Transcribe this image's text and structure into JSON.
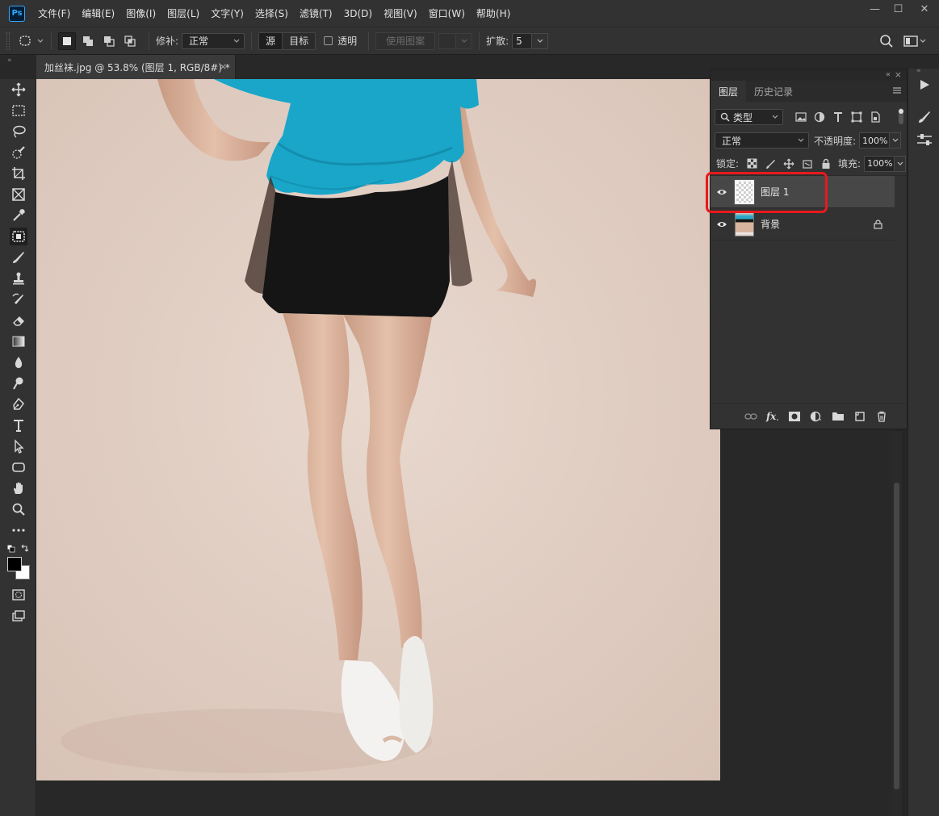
{
  "menu": {
    "logo": "Ps",
    "items": [
      "文件(F)",
      "编辑(E)",
      "图像(I)",
      "图层(L)",
      "文字(Y)",
      "选择(S)",
      "滤镜(T)",
      "3D(D)",
      "视图(V)",
      "窗口(W)",
      "帮助(H)"
    ]
  },
  "window_controls": {
    "minimize": "—",
    "maximize": "☐",
    "close": "✕"
  },
  "options": {
    "repair_label": "修补:",
    "repair_mode": "正常",
    "source": "源",
    "target": "目标",
    "transparent_label": "透明",
    "use_pattern": "使用图案",
    "diffusion_label": "扩散:",
    "diffusion_value": "5"
  },
  "document": {
    "tab_title": "加丝袜.jpg @ 53.8% (图层 1, RGB/8#) *",
    "close": "×"
  },
  "layers_panel": {
    "tabs": [
      "图层",
      "历史记录"
    ],
    "filter_label": "类型",
    "blend_mode": "正常",
    "opacity_label": "不透明度:",
    "opacity_value": "100%",
    "lock_label": "锁定:",
    "fill_label": "填充:",
    "fill_value": "100%",
    "layers": [
      {
        "name": "图层 1",
        "selected": true,
        "visible": true
      },
      {
        "name": "背景",
        "selected": false,
        "visible": true,
        "locked": true
      }
    ]
  },
  "colors": {
    "accent_highlight": "#e8191c",
    "ps_blue": "#31a8ff",
    "panel_bg": "#323232",
    "canvas_bg": "#e2d0c6"
  }
}
